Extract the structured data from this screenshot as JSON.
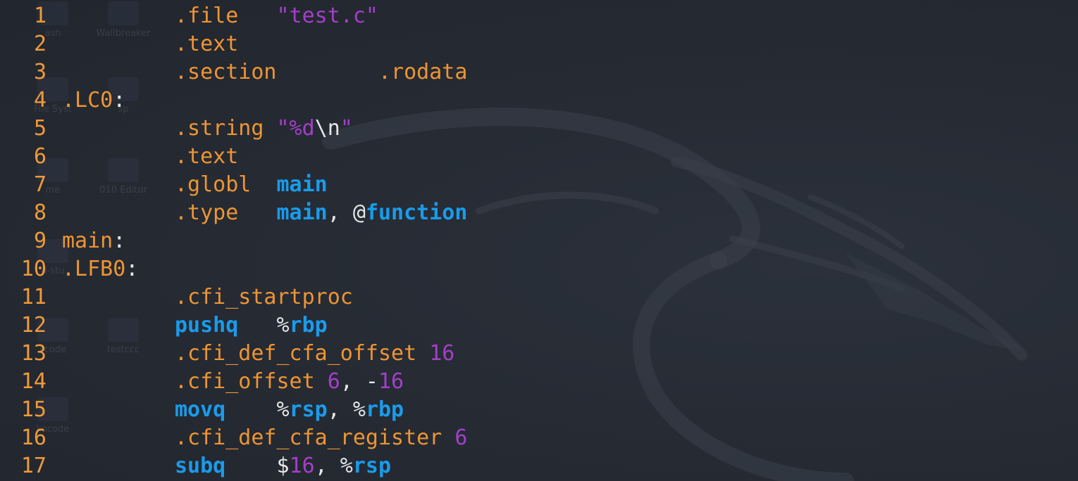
{
  "theme": {
    "background": "#252a33",
    "line_number_color": "#ef9a3a",
    "directive_color": "#ee9533",
    "string_color": "#a33fc9",
    "keyword_color": "#1a9bea",
    "punctuation_color": "#e6e6e6"
  },
  "desktop_icons": [
    "ash",
    "Wallbreaker",
    "File Syst",
    "sp",
    "me",
    "010 Editor",
    "d-stu",
    "scode",
    "testccc",
    "kocode"
  ],
  "lines": [
    {
      "num": "1",
      "tokens": [
        {
          "t": ".file   ",
          "c": "d"
        },
        {
          "t": "\"test.c\"",
          "c": "s"
        }
      ]
    },
    {
      "num": "2",
      "tokens": [
        {
          "t": ".text",
          "c": "d"
        }
      ]
    },
    {
      "num": "3",
      "tokens": [
        {
          "t": ".section        .rodata",
          "c": "d"
        }
      ]
    },
    {
      "num": "4",
      "label": true,
      "tokens": [
        {
          "t": ".LC0",
          "c": "d"
        },
        {
          "t": ":",
          "c": "w"
        }
      ]
    },
    {
      "num": "5",
      "tokens": [
        {
          "t": ".string ",
          "c": "d"
        },
        {
          "t": "\"%d",
          "c": "s"
        },
        {
          "t": "\\n",
          "c": "w"
        },
        {
          "t": "\"",
          "c": "s"
        }
      ]
    },
    {
      "num": "6",
      "tokens": [
        {
          "t": ".text",
          "c": "d"
        }
      ]
    },
    {
      "num": "7",
      "tokens": [
        {
          "t": ".globl  ",
          "c": "d"
        },
        {
          "t": "main",
          "c": "k"
        }
      ]
    },
    {
      "num": "8",
      "tokens": [
        {
          "t": ".type   ",
          "c": "d"
        },
        {
          "t": "main",
          "c": "k"
        },
        {
          "t": ", @",
          "c": "w"
        },
        {
          "t": "function",
          "c": "k"
        }
      ]
    },
    {
      "num": "9",
      "label": true,
      "tokens": [
        {
          "t": "main",
          "c": "d"
        },
        {
          "t": ":",
          "c": "w"
        }
      ]
    },
    {
      "num": "10",
      "label": true,
      "tokens": [
        {
          "t": ".LFB0",
          "c": "d"
        },
        {
          "t": ":",
          "c": "w"
        }
      ]
    },
    {
      "num": "11",
      "tokens": [
        {
          "t": ".cfi_startproc",
          "c": "d"
        }
      ]
    },
    {
      "num": "12",
      "tokens": [
        {
          "t": "pushq",
          "c": "k"
        },
        {
          "t": "   %",
          "c": "w"
        },
        {
          "t": "rbp",
          "c": "k"
        }
      ]
    },
    {
      "num": "13",
      "tokens": [
        {
          "t": ".cfi_def_cfa_offset ",
          "c": "d"
        },
        {
          "t": "16",
          "c": "s"
        }
      ]
    },
    {
      "num": "14",
      "tokens": [
        {
          "t": ".cfi_offset ",
          "c": "d"
        },
        {
          "t": "6",
          "c": "s"
        },
        {
          "t": ", -",
          "c": "w"
        },
        {
          "t": "16",
          "c": "s"
        }
      ]
    },
    {
      "num": "15",
      "tokens": [
        {
          "t": "movq",
          "c": "k"
        },
        {
          "t": "    %",
          "c": "w"
        },
        {
          "t": "rsp",
          "c": "k"
        },
        {
          "t": ", %",
          "c": "w"
        },
        {
          "t": "rbp",
          "c": "k"
        }
      ]
    },
    {
      "num": "16",
      "tokens": [
        {
          "t": ".cfi_def_cfa_register ",
          "c": "d"
        },
        {
          "t": "6",
          "c": "s"
        }
      ]
    },
    {
      "num": "17",
      "tokens": [
        {
          "t": "subq",
          "c": "k"
        },
        {
          "t": "    $",
          "c": "w"
        },
        {
          "t": "16",
          "c": "s"
        },
        {
          "t": ", %",
          "c": "w"
        },
        {
          "t": "rsp",
          "c": "k"
        }
      ]
    }
  ]
}
